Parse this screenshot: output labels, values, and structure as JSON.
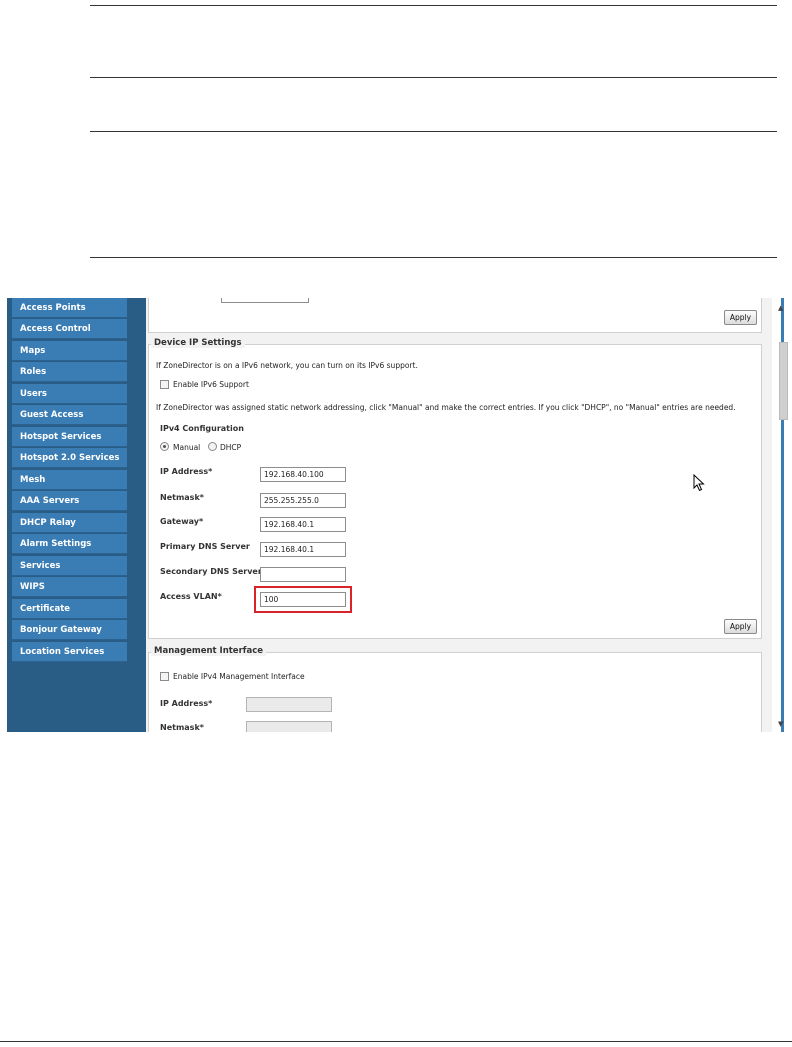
{
  "sidebar": {
    "items": [
      {
        "label": "Access Points"
      },
      {
        "label": "Access Control"
      },
      {
        "label": "Maps"
      },
      {
        "label": "Roles"
      },
      {
        "label": "Users"
      },
      {
        "label": "Guest Access"
      },
      {
        "label": "Hotspot Services"
      },
      {
        "label": "Hotspot 2.0 Services"
      },
      {
        "label": "Mesh"
      },
      {
        "label": "AAA Servers"
      },
      {
        "label": "DHCP Relay"
      },
      {
        "label": "Alarm Settings"
      },
      {
        "label": "Services"
      },
      {
        "label": "WIPS"
      },
      {
        "label": "Certificate"
      },
      {
        "label": "Bonjour Gateway"
      },
      {
        "label": "Location Services"
      }
    ]
  },
  "top_panel": {
    "apply_label": "Apply"
  },
  "device_ip": {
    "title": "Device IP Settings",
    "ipv6_note": "If ZoneDirector is on a IPv6 network, you can turn on its IPv6 support.",
    "enable_ipv6_label": "Enable IPv6 Support",
    "static_note": "If ZoneDirector was assigned static network addressing, click \"Manual\" and make the correct entries. If you click \"DHCP\", no \"Manual\" entries are needed.",
    "ipv4_config_label": "IPv4 Configuration",
    "manual_label": "Manual",
    "dhcp_label": "DHCP",
    "fields": {
      "ip_address_label": "IP Address*",
      "ip_address_value": "192.168.40.100",
      "netmask_label": "Netmask*",
      "netmask_value": "255.255.255.0",
      "gateway_label": "Gateway*",
      "gateway_value": "192.168.40.1",
      "primary_dns_label": "Primary DNS Server",
      "primary_dns_value": "192.168.40.1",
      "secondary_dns_label": "Secondary DNS Server",
      "secondary_dns_value": "",
      "access_vlan_label": "Access VLAN*",
      "access_vlan_value": "100"
    },
    "apply_label": "Apply"
  },
  "mgmt": {
    "title": "Management Interface",
    "enable_label": "Enable IPv4 Management Interface",
    "ip_address_label": "IP Address*",
    "netmask_label": "Netmask*"
  },
  "colors": {
    "sidebar_bg": "#2a5d86",
    "nav_item_bg": "#3a7cb4",
    "highlight": "#d8232a"
  }
}
